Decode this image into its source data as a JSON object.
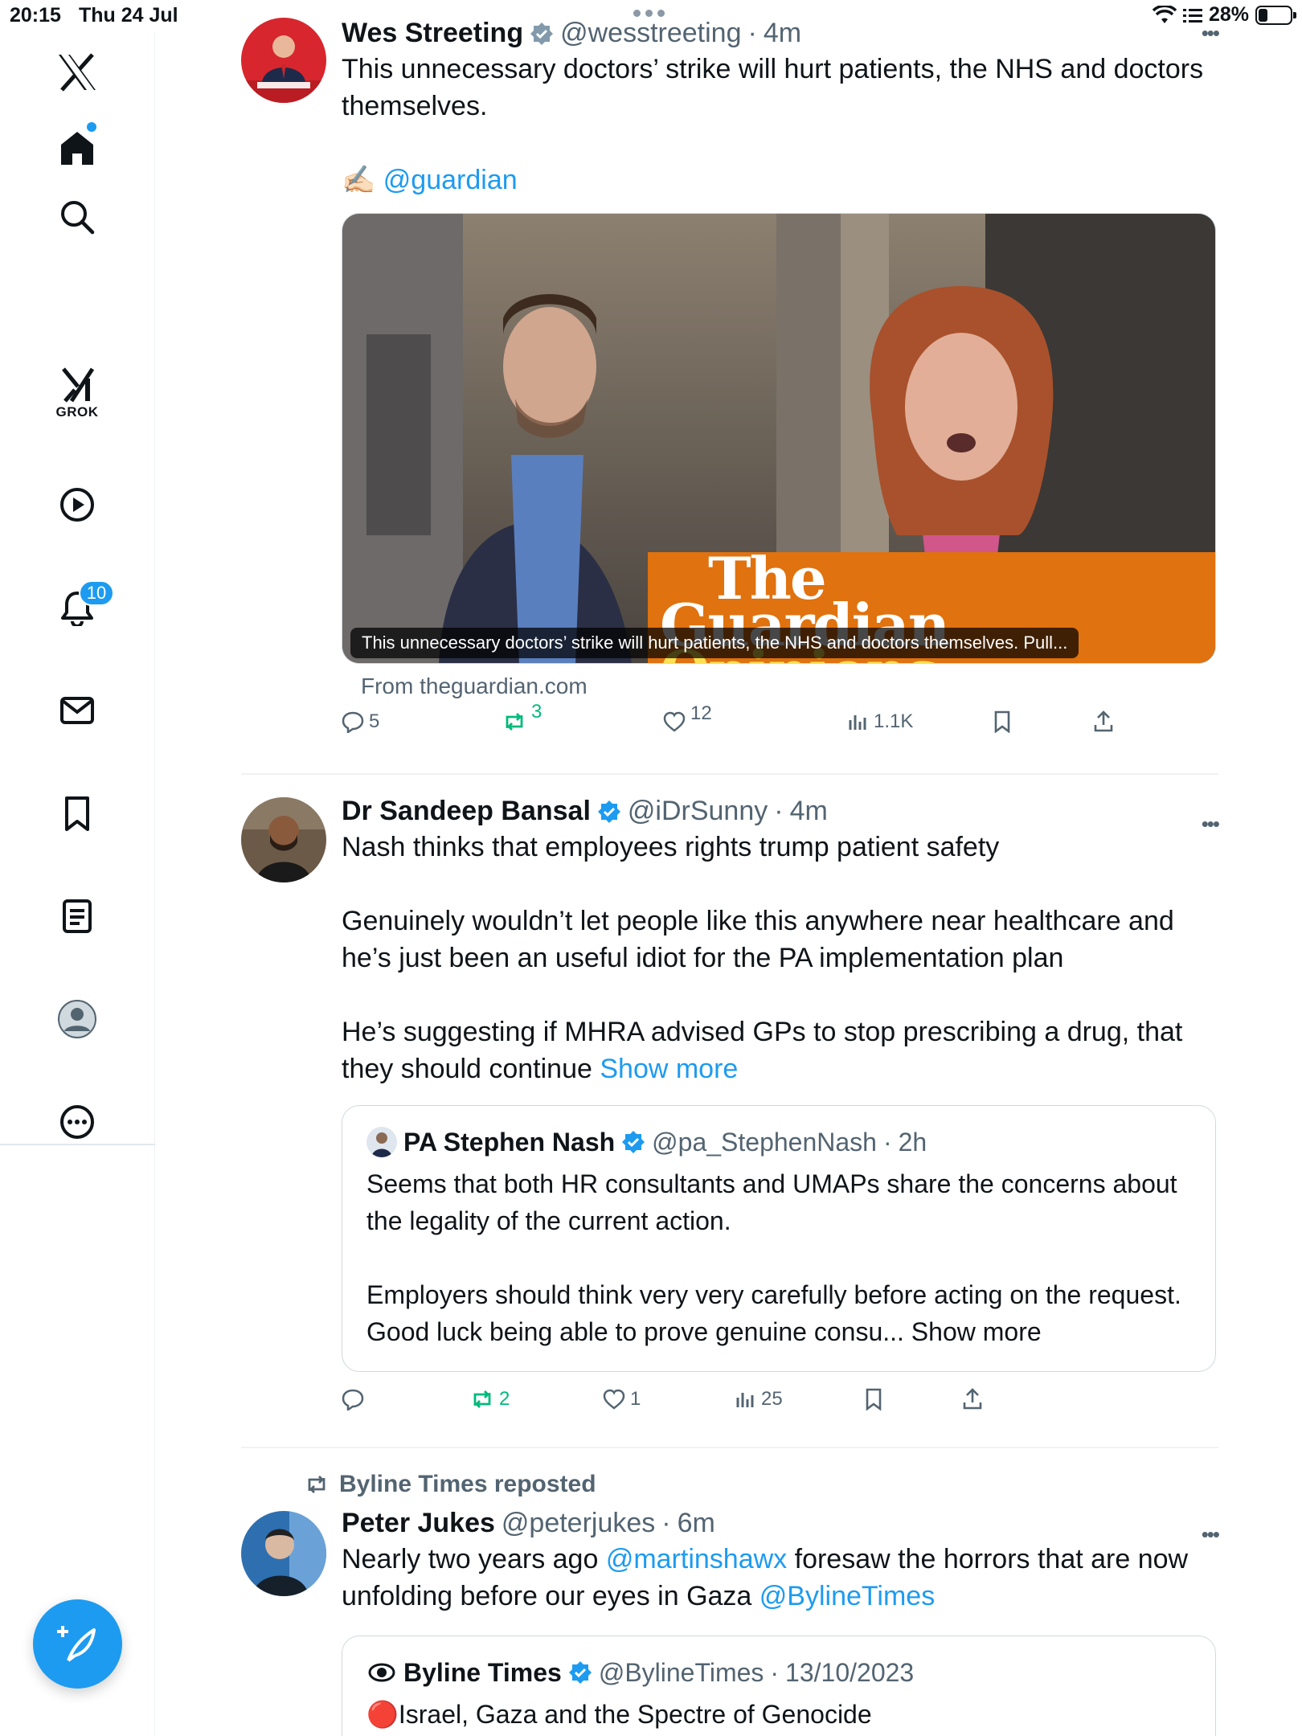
{
  "status_bar": {
    "time": "20:15",
    "date": "Thu 24 Jul",
    "battery": "28%",
    "battery_level": 0.28
  },
  "sidebar": {
    "grok_label": "GROK",
    "notification_count": "10",
    "items": [
      "x-logo-icon",
      "home-icon",
      "search-icon",
      "grok-icon",
      "video-icon",
      "notifications-icon",
      "messages-icon",
      "bookmarks-icon",
      "lists-icon",
      "profile-icon",
      "more-icon"
    ]
  },
  "posts": [
    {
      "name": "Wes Streeting",
      "handle": "@wesstreeting",
      "time": "4m",
      "text": "This unnecessary doctors’ strike will hurt patients, the NHS and doctors themselves.",
      "credit_emoji": "✍🏻",
      "credit_link": "@guardian",
      "card": {
        "brand": "The",
        "brand2": "Guardian",
        "brand3": "Opinions",
        "caption": "This unnecessary doctors’ strike will hurt patients, the NHS and doctors themselves. Pull...",
        "source": "From theguardian.com"
      },
      "stats": {
        "replies": "5",
        "reposts": "3",
        "likes": "12",
        "views": "1.1K"
      }
    },
    {
      "name": "Dr Sandeep Bansal",
      "handle": "@iDrSunny",
      "time": "4m",
      "text_p1": "Nash thinks that employees rights trump patient safety",
      "text_p2": "Genuinely wouldn’t let people like this anywhere near healthcare and he’s just been an useful idiot for the PA implementation plan",
      "text_p3": "He’s suggesting if MHRA advised GPs to stop prescribing a drug, that they should continue",
      "show_more": "Show more",
      "quote": {
        "name": "PA Stephen Nash",
        "handle": "@pa_StephenNash",
        "time": "2h",
        "text_p1": "Seems that both HR consultants and UMAPs share the concerns about the legality of the current action.",
        "text_p2": "Employers should think very very carefully before acting on the request. Good luck being able to prove genuine consu...",
        "show_more": "Show more"
      },
      "stats": {
        "replies": "",
        "reposts": "2",
        "likes": "1",
        "views": "25"
      }
    },
    {
      "repost_by": "Byline Times reposted",
      "name": "Peter Jukes",
      "handle": "@peterjukes",
      "time": "6m",
      "text_a": "Nearly two years ago ",
      "link1": "@martinshawx",
      "text_b": " foresaw the horrors that are now unfolding before our eyes in Gaza ",
      "link2": "@BylineTimes",
      "quote": {
        "name": "Byline Times",
        "handle": "@BylineTimes",
        "time": "13/10/2023",
        "title_emoji": "🔴",
        "title": "Israel, Gaza and the Spectre of Genocide"
      }
    }
  ],
  "colors": {
    "accent": "#1d9bf0",
    "repost": "#00ba7c",
    "muted": "#536471",
    "guardian_orange": "#e0720f"
  }
}
